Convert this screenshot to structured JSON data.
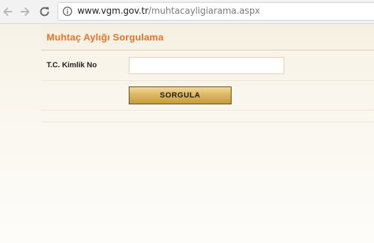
{
  "browser": {
    "url_host": "www.vgm.gov.tr",
    "url_path": "/muhtacayligiarama.aspx"
  },
  "page": {
    "title": "Muhtaç Aylığı Sorgulama"
  },
  "form": {
    "tc_label": "T.C. Kimlik No",
    "tc_value": "",
    "submit_label": "SORGULA"
  },
  "colors": {
    "title": "#e8742b",
    "button_gold": "#dcb764",
    "input_border": "#efc9b1"
  }
}
